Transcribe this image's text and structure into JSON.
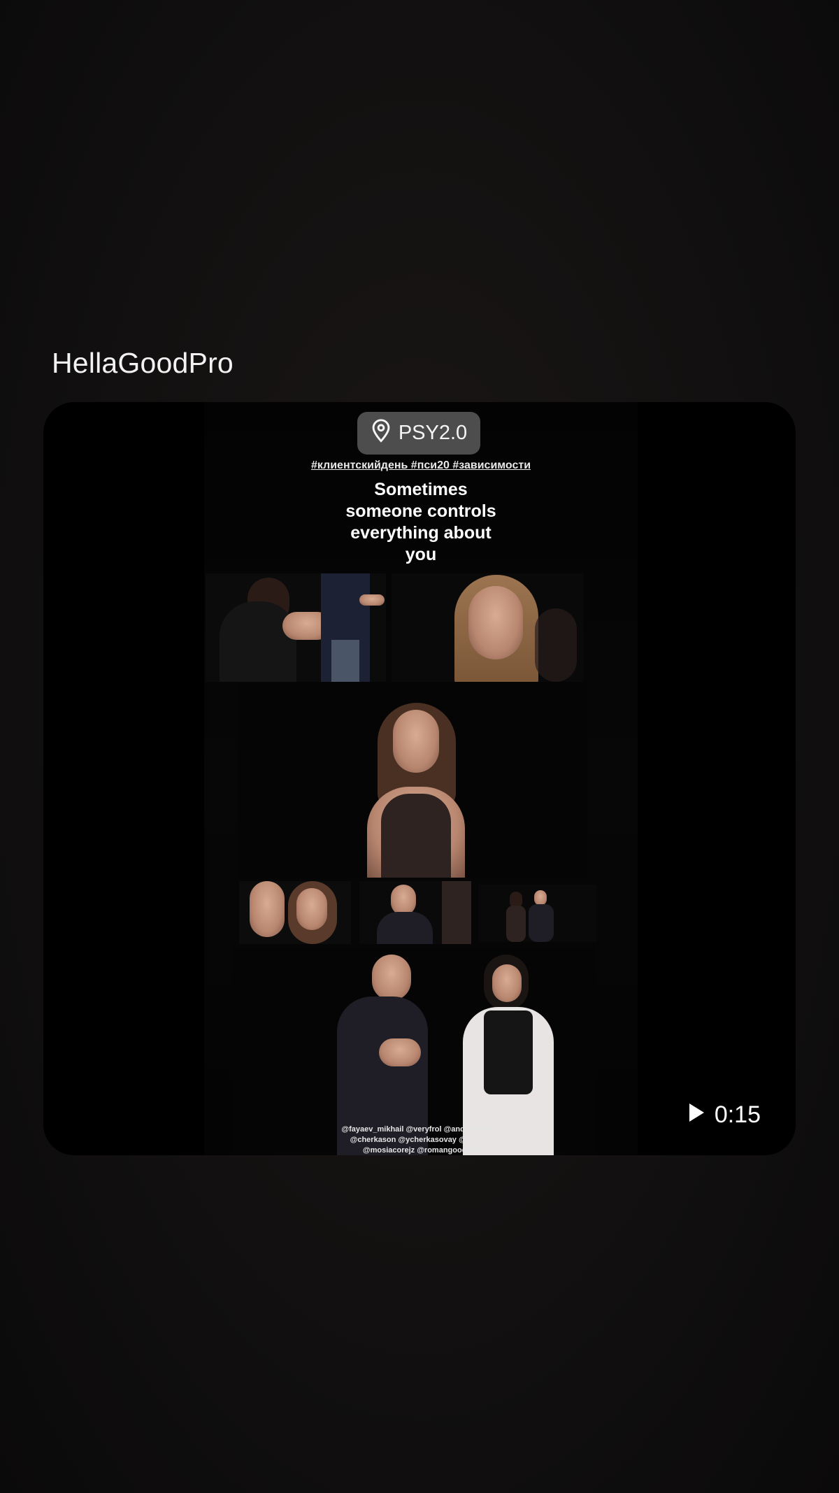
{
  "post": {
    "username": "HellaGoodPro",
    "location": "PSY2.0",
    "duration": "0:15"
  },
  "video": {
    "hashtags": "#клиентскийдень #пси20 #зависимости",
    "headline": [
      "Sometimes",
      "someone controls",
      "everything about",
      "you"
    ],
    "credits": [
      "@fayaev_mikhail @veryfrol @andyshishkin",
      "@cherkason @ycherkasovay @jonn_ri",
      "@mosiacorejz @romangoodpro"
    ],
    "watermark": "PSY2.0"
  },
  "icons": {
    "location": "map-pin-icon",
    "play": "play-icon"
  },
  "colors": {
    "background": "#121010",
    "card": "#000000",
    "pill": "#5a5a5c",
    "text": "#f2f2f2"
  }
}
